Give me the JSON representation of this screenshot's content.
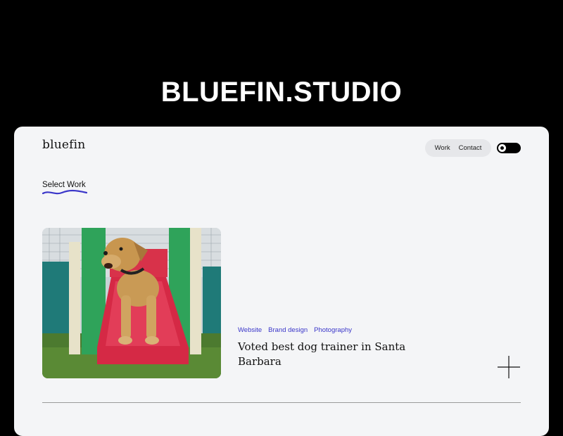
{
  "hero": {
    "title": "BLUEFIN.STUDIO"
  },
  "site": {
    "logo": "bluefin",
    "nav": {
      "items": [
        {
          "label": "Work"
        },
        {
          "label": "Contact"
        }
      ]
    },
    "theme_toggle": {
      "state": "dark"
    },
    "section_label": "Select Work",
    "project": {
      "tags": [
        "Website",
        "Brand design",
        "Photography"
      ],
      "title": "Voted best dog trainer in Santa Barbara",
      "image_icon": "dog-on-slide-photo"
    },
    "icons": {
      "expand": "plus-icon"
    },
    "colors": {
      "page_bg": "#000000",
      "card_bg": "#f4f5f7",
      "accent": "#3a36c9",
      "pill_bg": "#e6e7ea"
    }
  }
}
